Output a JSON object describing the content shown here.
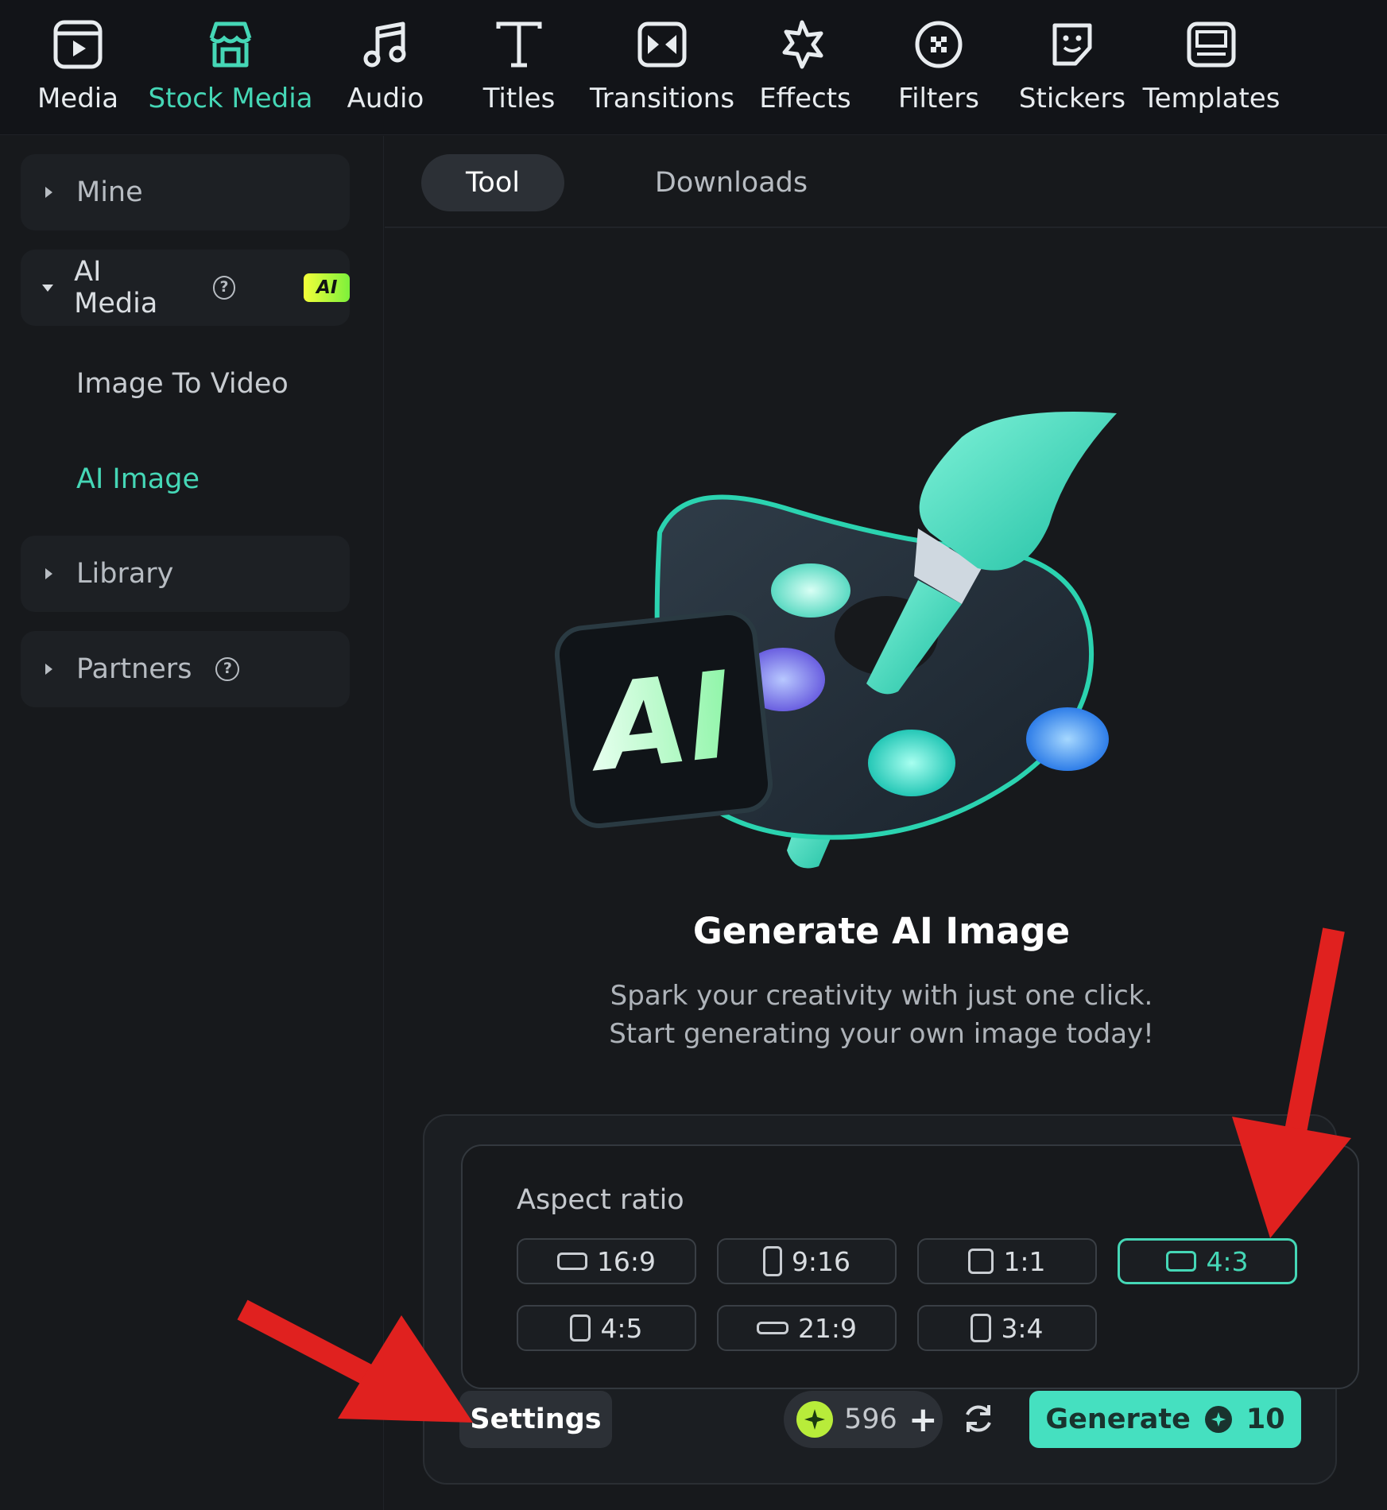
{
  "toolbar": {
    "items": [
      {
        "label": "Media",
        "icon": "media-icon"
      },
      {
        "label": "Stock Media",
        "icon": "stock-media-icon",
        "active": true
      },
      {
        "label": "Audio",
        "icon": "music-note-icon"
      },
      {
        "label": "Titles",
        "icon": "text-t-icon"
      },
      {
        "label": "Transitions",
        "icon": "transitions-icon"
      },
      {
        "label": "Effects",
        "icon": "effects-star-icon"
      },
      {
        "label": "Filters",
        "icon": "filters-icon"
      },
      {
        "label": "Stickers",
        "icon": "sticker-icon"
      },
      {
        "label": "Templates",
        "icon": "templates-icon"
      }
    ],
    "accent": "#45d7b6"
  },
  "sidebar": {
    "mine": "Mine",
    "ai_media": "AI Media",
    "ai_badge": "AI",
    "help_glyph": "?",
    "image_to_video": "Image To Video",
    "ai_image": "AI Image",
    "library": "Library",
    "partners": "Partners"
  },
  "tabs": {
    "tool": "Tool",
    "downloads": "Downloads"
  },
  "hero": {
    "badge_text": "AI",
    "title": "Generate AI Image",
    "subtitle_line1": "Spark your creativity with just one click.",
    "subtitle_line2": "Start generating your own image today!"
  },
  "aspect_ratio": {
    "label": "Aspect ratio",
    "options": [
      "16:9",
      "9:16",
      "1:1",
      "4:3",
      "4:5",
      "21:9",
      "3:4"
    ],
    "selected": "4:3"
  },
  "footer": {
    "settings": "Settings",
    "credits": "596",
    "plus": "+",
    "generate": "Generate",
    "generate_cost": "10",
    "generate_color": "#45e0c0"
  },
  "annotations": {
    "arrow_color": "#e0211f"
  }
}
